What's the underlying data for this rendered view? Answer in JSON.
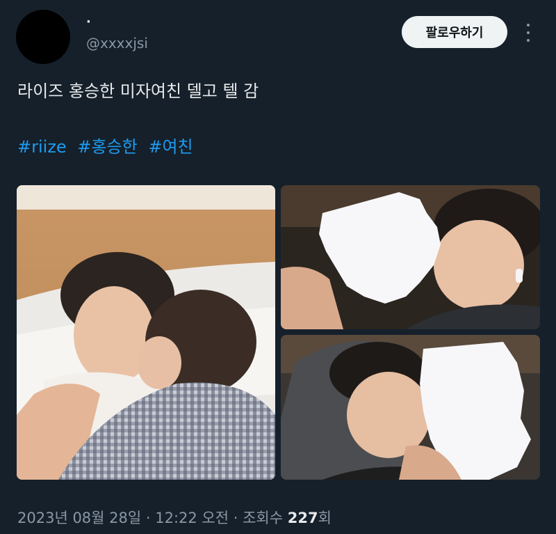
{
  "author": {
    "display_name": "·",
    "handle": "@xxxxjsi"
  },
  "follow_label": "팔로우하기",
  "tweet_text": "라이즈 홍승한 미자여친 델고 텔 감",
  "hashtags": [
    "#riize",
    "#홍승한",
    "#여친"
  ],
  "meta": {
    "date_time": "2023년 08월 28일 · 12:22 오전 · 조회수 ",
    "views": "227",
    "views_suffix": "회"
  },
  "icons": {
    "more": "more-vertical-icon"
  },
  "colors": {
    "background": "#15202b",
    "text": "#e7e9ea",
    "muted": "#8b98a5",
    "link": "#1d9bf0",
    "follow_bg": "#eff3f4"
  }
}
